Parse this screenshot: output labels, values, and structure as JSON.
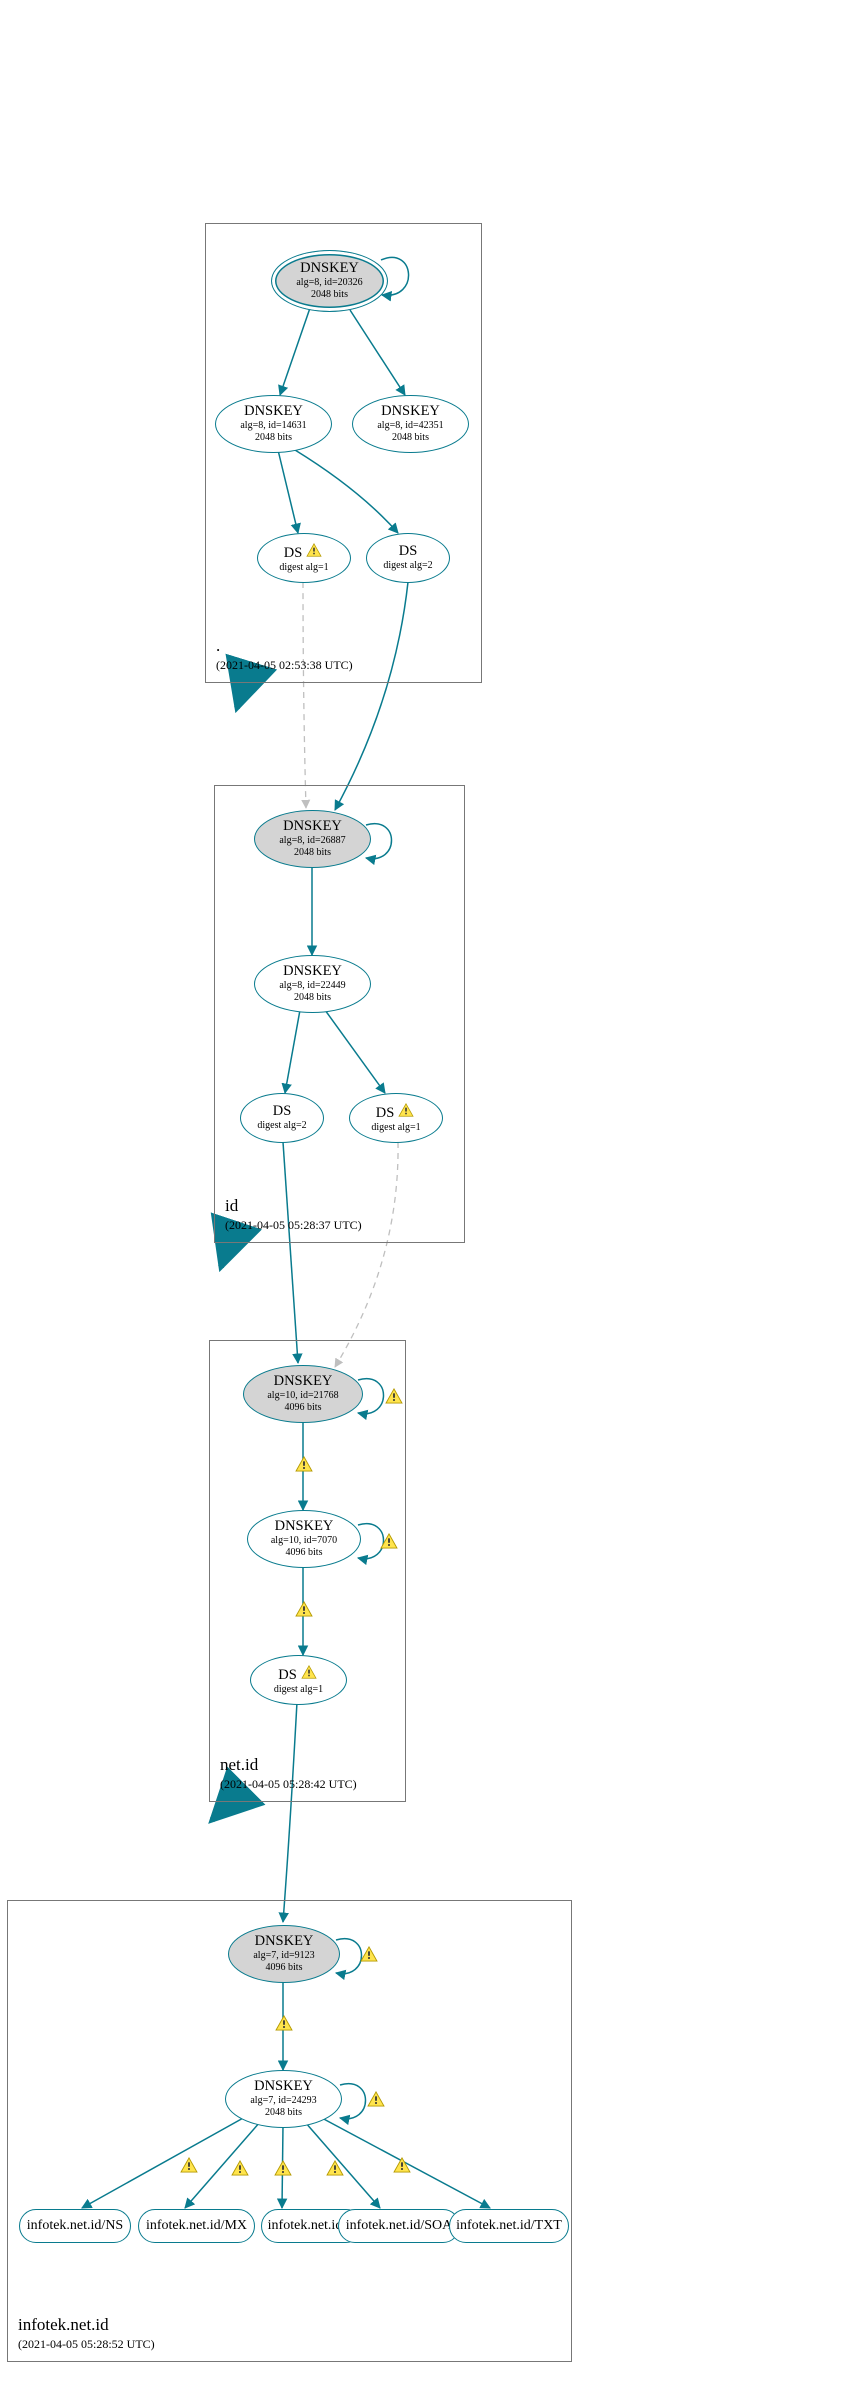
{
  "zones": {
    "root": {
      "name": ".",
      "timestamp": "(2021-04-05 02:53:38 UTC)"
    },
    "id": {
      "name": "id",
      "timestamp": "(2021-04-05 05:28:37 UTC)"
    },
    "netid": {
      "name": "net.id",
      "timestamp": "(2021-04-05 05:28:42 UTC)"
    },
    "infotek": {
      "name": "infotek.net.id",
      "timestamp": "(2021-04-05 05:28:52 UTC)"
    }
  },
  "nodes": {
    "root_ksk": {
      "t": "DNSKEY",
      "s1": "alg=8, id=20326",
      "s2": "2048 bits"
    },
    "root_zsk1": {
      "t": "DNSKEY",
      "s1": "alg=8, id=14631",
      "s2": "2048 bits"
    },
    "root_zsk2": {
      "t": "DNSKEY",
      "s1": "alg=8, id=42351",
      "s2": "2048 bits"
    },
    "root_ds1": {
      "t": "DS",
      "s1": "digest alg=1"
    },
    "root_ds2": {
      "t": "DS",
      "s1": "digest alg=2"
    },
    "id_ksk": {
      "t": "DNSKEY",
      "s1": "alg=8, id=26887",
      "s2": "2048 bits"
    },
    "id_zsk": {
      "t": "DNSKEY",
      "s1": "alg=8, id=22449",
      "s2": "2048 bits"
    },
    "id_ds2": {
      "t": "DS",
      "s1": "digest alg=2"
    },
    "id_ds1": {
      "t": "DS",
      "s1": "digest alg=1"
    },
    "netid_ksk": {
      "t": "DNSKEY",
      "s1": "alg=10, id=21768",
      "s2": "4096 bits"
    },
    "netid_zsk": {
      "t": "DNSKEY",
      "s1": "alg=10, id=7070",
      "s2": "4096 bits"
    },
    "netid_ds1": {
      "t": "DS",
      "s1": "digest alg=1"
    },
    "inf_ksk": {
      "t": "DNSKEY",
      "s1": "alg=7, id=9123",
      "s2": "4096 bits"
    },
    "inf_zsk": {
      "t": "DNSKEY",
      "s1": "alg=7, id=24293",
      "s2": "2048 bits"
    },
    "rr_ns": "infotek.net.id/NS",
    "rr_mx": "infotek.net.id/MX",
    "rr_a": "infotek.net.id/A",
    "rr_soa": "infotek.net.id/SOA",
    "rr_txt": "infotek.net.id/TXT"
  },
  "colors": {
    "stroke": "#097b8e",
    "dashed": "#bfbfbf",
    "warnfill": "#ffe44d",
    "warnstroke": "#b59a00"
  }
}
